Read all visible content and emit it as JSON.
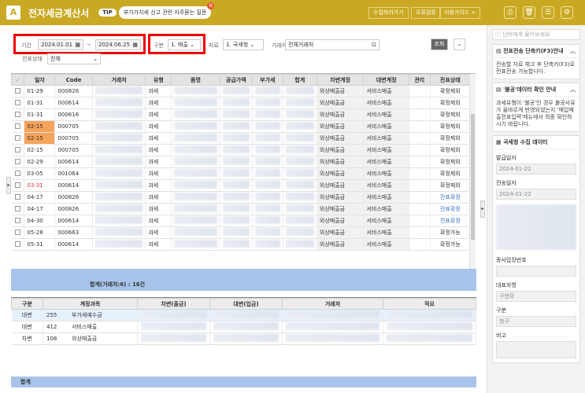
{
  "app": {
    "title": "전자세금계산서",
    "tip_badge": "TIP",
    "tip_text": "부가가치세 신고 관련 자주묻는 질문",
    "tip_dot": "N"
  },
  "toolbar": {
    "btn1": "수집하러가기",
    "btn2": "오류검증",
    "btn3": "이용가이드 >"
  },
  "filter": {
    "period_label": "기간",
    "date_from": "2024.01.01",
    "date_sep": "~",
    "date_to": "2024.06.25",
    "div_label": "구분",
    "div_value": "1. 매출",
    "src_label": "자료",
    "src_value": "1. 국세청",
    "partner_label": "거래처",
    "partner_value": "전체거래처",
    "search_btn": "조회",
    "status_label": "전표상태",
    "status_value": "전체"
  },
  "grid": {
    "columns": [
      "일자",
      "Code",
      "거래처",
      "유형",
      "품명",
      "공급가액",
      "부가세",
      "합계",
      "차변계정",
      "대변계정",
      "관리",
      "전표상태"
    ],
    "rows": [
      {
        "date": "01-29",
        "code": "000826",
        "type": "과세",
        "debit": "외상매출금",
        "credit": "서비스매출",
        "status": "확정제외"
      },
      {
        "date": "01-31",
        "code": "000614",
        "type": "과세",
        "debit": "외상매출금",
        "credit": "서비스매출",
        "status": "확정제외"
      },
      {
        "date": "01-31",
        "code": "000616",
        "type": "과세",
        "debit": "외상매출금",
        "credit": "서비스매출",
        "status": "확정제외"
      },
      {
        "date": "02-15",
        "code": "000705",
        "type": "과세",
        "debit": "외상매출금",
        "credit": "서비스매출",
        "status": "확정제외"
      },
      {
        "date": "02-15",
        "code": "000705",
        "type": "과세",
        "debit": "외상매출금",
        "credit": "서비스매출",
        "status": "확정제외"
      },
      {
        "date": "02-15",
        "code": "000705",
        "type": "과세",
        "debit": "외상매출금",
        "credit": "서비스매출",
        "status": "확정제외"
      },
      {
        "date": "02-29",
        "code": "000614",
        "type": "과세",
        "debit": "외상매출금",
        "credit": "서비스매출",
        "status": "확정제외"
      },
      {
        "date": "03-05",
        "code": "001064",
        "type": "과세",
        "debit": "외상매출금",
        "credit": "서비스매출",
        "status": "확정제외"
      },
      {
        "date": "03-31",
        "code": "000614",
        "type": "과세",
        "debit": "외상매출금",
        "credit": "서비스매출",
        "status": "확정제외"
      },
      {
        "date": "04-17",
        "code": "000826",
        "type": "과세",
        "debit": "외상매출금",
        "credit": "서비스매출",
        "status": "전표확정"
      },
      {
        "date": "04-17",
        "code": "000826",
        "type": "과세",
        "debit": "외상매출금",
        "credit": "서비스매출",
        "status": "전표확정"
      },
      {
        "date": "04-30",
        "code": "000614",
        "type": "과세",
        "debit": "외상매출금",
        "credit": "서비스매출",
        "status": "전표확정"
      },
      {
        "date": "05-28",
        "code": "000663",
        "type": "과세",
        "debit": "외상매출금",
        "credit": "서비스매출",
        "status": "확정가능"
      },
      {
        "date": "05-31",
        "code": "000614",
        "type": "과세",
        "debit": "외상매출금",
        "credit": "서비스매출",
        "status": "확정가능"
      }
    ],
    "sum_label": "합계(거래처:6) : 16건"
  },
  "detail": {
    "columns": [
      "구분",
      "계정과목",
      "차변(출금)",
      "대변(입금)",
      "거래처",
      "적요"
    ],
    "rows": [
      {
        "div": "대변",
        "code": "255",
        "account": "부가세예수금"
      },
      {
        "div": "대변",
        "code": "412",
        "account": "서비스매출"
      },
      {
        "div": "차변",
        "code": "108",
        "account": "외상매출금"
      }
    ],
    "sum_label": "합계"
  },
  "right": {
    "search_placeholder": "단비에게 물어보세요",
    "card1_title": "전표전송 단축키(F3)안내",
    "card1_body": "전송할 자료 체크 후 단축키(F3)로 전표전송 가능합니다.",
    "card2_title": "'불공'데이터 확인 안내",
    "card2_body": "과세유형이 '불공'인 경우 불공사유가 올바르게 반영되었는지 '매입매출전표입력'메뉴에서 최종 확인하시기 바랍니다.",
    "card3_title": "국세청 수집 데이터",
    "issue_label": "발급일자",
    "issue_value": "2024-01-22",
    "send_label": "전송일자",
    "send_value": "2024-01-22",
    "sub_label": "종사업장번호",
    "rep_label": "대표자명",
    "rep_value": "구현모",
    "div_label": "구분",
    "div_value": "청구",
    "note_label": "비고"
  }
}
